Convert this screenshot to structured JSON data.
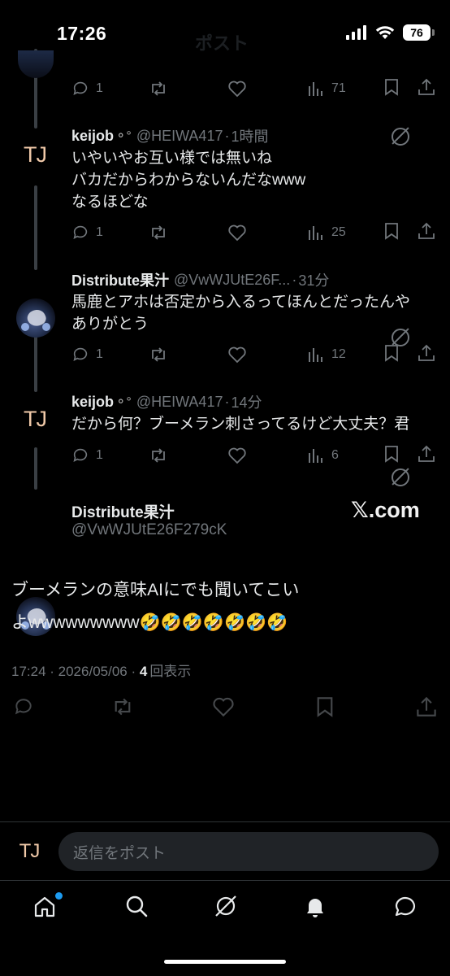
{
  "status_bar": {
    "time": "17:26",
    "battery": "76",
    "signal_icon": "cellular-signal-icon",
    "wifi_icon": "wifi-icon"
  },
  "header": {
    "title": "ポスト"
  },
  "replies": [
    {
      "name": "",
      "handle": "",
      "time": "",
      "lines": [],
      "counts": {
        "reply": "1",
        "repost": "",
        "like": "",
        "views": "71"
      }
    },
    {
      "name": "keijob",
      "handle": "@HEIWA417",
      "time": "1時間",
      "lines": [
        "いやいやお互い様では無いね",
        "バカだからわからないんだなwww",
        "なるほどな"
      ],
      "counts": {
        "reply": "1",
        "repost": "",
        "like": "",
        "views": "25"
      }
    },
    {
      "name": "Distribute果汁",
      "handle": "@VwWJUtE26F...",
      "time": "31分",
      "lines": [
        "馬鹿とアホは否定から入るってほんとだったんや",
        "ありがとう"
      ],
      "counts": {
        "reply": "1",
        "repost": "",
        "like": "",
        "views": "12"
      }
    },
    {
      "name": "keijob",
      "handle": "@HEIWA417",
      "time": "14分",
      "lines": [
        "だから何？ブーメラン刺さってるけど大丈夫？君"
      ],
      "counts": {
        "reply": "1",
        "repost": "",
        "like": "",
        "views": "6"
      }
    }
  ],
  "avatar_initials": "TJ",
  "main_post": {
    "name": "Distribute果汁",
    "handle": "@VwWJUtE26F279cK",
    "watermark": "𝕏.com",
    "line1": "ブーメランの意味AIにでも聞いてこい",
    "line2": "よwwwwwwwww🤣🤣🤣🤣🤣🤣🤣",
    "timestamp": "17:24 · 2026/05/06 · ",
    "view_count": "4",
    "view_label": "回表示"
  },
  "composer": {
    "placeholder": "返信をポスト"
  },
  "tabs": [
    "home-icon",
    "search-icon",
    "grok-icon",
    "notifications-icon",
    "messages-icon"
  ]
}
